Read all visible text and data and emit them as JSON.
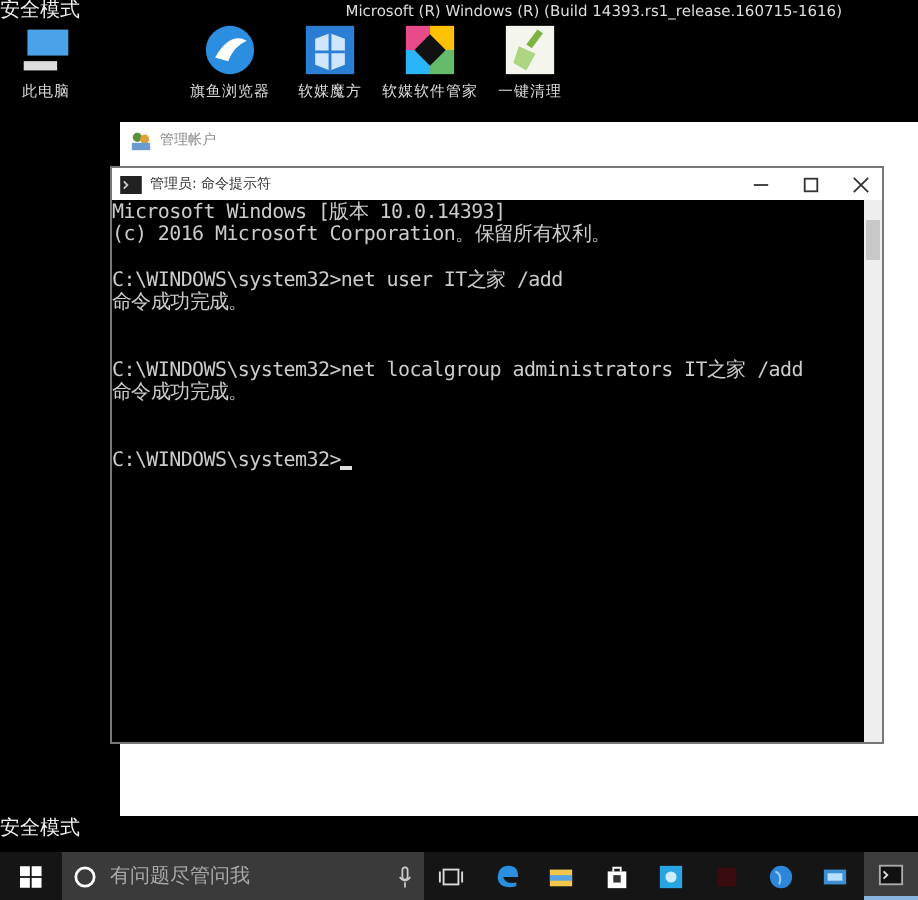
{
  "desktop": {
    "mode_label_top": "安全模式",
    "build_info": "Microsoft (R) Windows (R) (Build 14393.rs1_release.160715-1616)",
    "mode_label_bottom": "安全模式",
    "icons": [
      {
        "label": "此电脑",
        "kind": "computer"
      },
      {
        "label": "旗鱼浏览器",
        "kind": "browser"
      },
      {
        "label": "软媒魔方",
        "kind": "cube"
      },
      {
        "label": "软媒软件管家",
        "kind": "manager"
      },
      {
        "label": "一键清理",
        "kind": "broom"
      }
    ]
  },
  "back_window": {
    "title": "管理帐户"
  },
  "cmd_window": {
    "title": "管理员: 命令提示符",
    "blocks": [
      {
        "lines": [
          "Microsoft Windows [版本 10.0.14393]",
          "(c) 2016 Microsoft Corporation。保留所有权利。"
        ]
      },
      {
        "lines": [
          "C:\\WINDOWS\\system32>net user IT之家 /add",
          "命令成功完成。"
        ]
      },
      {
        "lines": [
          "C:\\WINDOWS\\system32>net localgroup administrators IT之家 /add",
          "命令成功完成。"
        ]
      },
      {
        "lines": [
          "C:\\WINDOWS\\system32>"
        ],
        "cursor": true
      }
    ]
  },
  "taskbar": {
    "search": {
      "placeholder": "有问题尽管问我"
    },
    "apps": [
      {
        "kind": "taskview",
        "active": false
      },
      {
        "kind": "edge",
        "active": false
      },
      {
        "kind": "folder",
        "active": false
      },
      {
        "kind": "store",
        "active": false
      },
      {
        "kind": "blue",
        "active": false
      },
      {
        "kind": "red",
        "active": false
      },
      {
        "kind": "globe",
        "active": false
      },
      {
        "kind": "screen",
        "active": false
      },
      {
        "kind": "cmd",
        "active": true
      }
    ]
  }
}
